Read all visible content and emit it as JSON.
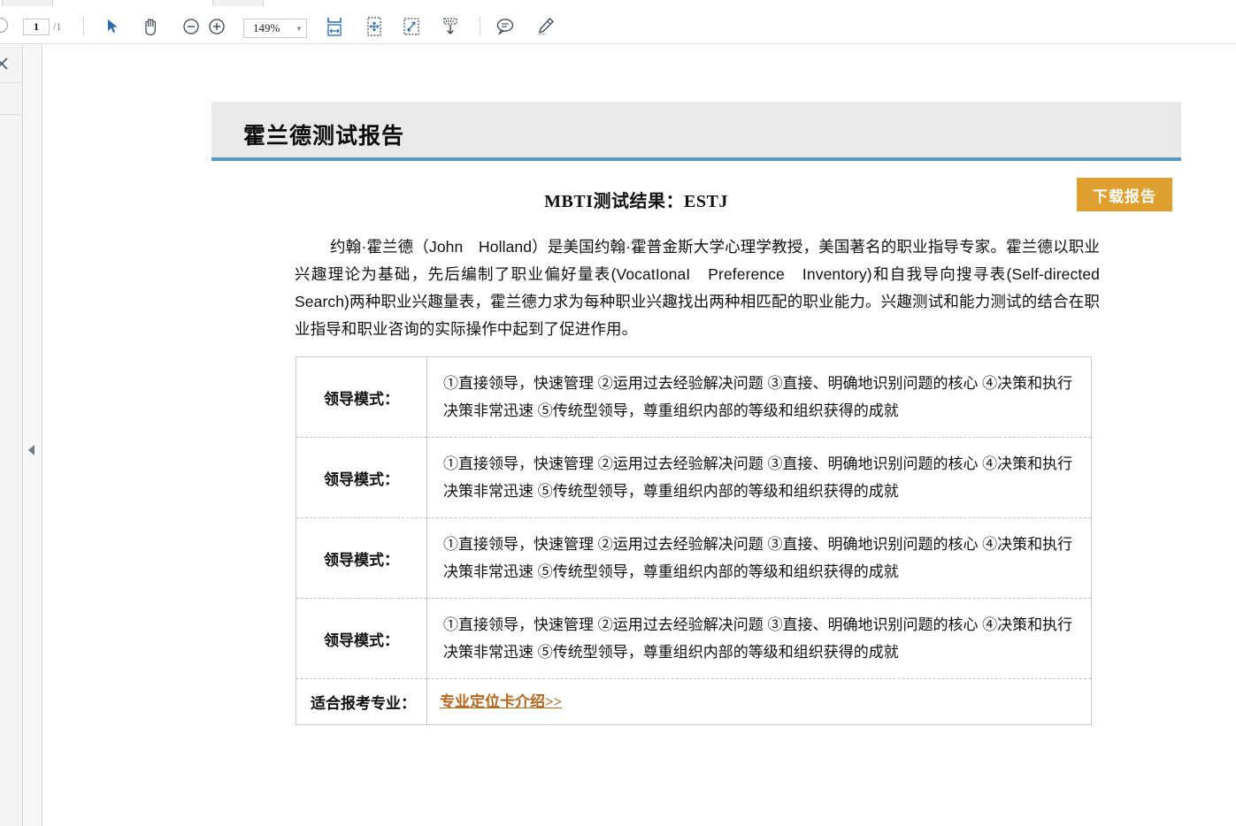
{
  "toolbar": {
    "page_number": "1",
    "page_total": "/1",
    "zoom_value": "149%",
    "zoom_caret": "▼",
    "icons": {
      "nav_back": "back-circle-icon",
      "select": "select-cursor-icon",
      "hand": "hand-tool-icon",
      "zoom_out": "zoom-out-icon",
      "zoom_in": "zoom-in-icon",
      "fit_width": "fit-width-icon",
      "fit_page": "fit-page-icon",
      "zoom_selection": "zoom-to-selection-icon",
      "snapshot": "snapshot-download-icon",
      "comment": "comment-bubble-icon",
      "highlight": "highlighter-pen-icon"
    }
  },
  "left_panel": {
    "close_label": "close-panel-icon",
    "collapse_label": "collapse-panel-arrow"
  },
  "report": {
    "header_title": "霍兰德测试报告",
    "mbti_line": "MBTI测试结果：ESTJ",
    "download_button": "下载报告",
    "intro": "约翰·霍兰德（John　Holland）是美国约翰·霍普金斯大学心理学教授，美国著名的职业指导专家。霍兰德以职业兴趣理论为基础，先后编制了职业偏好量表(VocatIonaI　Preference　Inventory)和自我导向搜寻表(Self-directed　Search)两种职业兴趣量表，霍兰德力求为每种职业兴趣找出两种相匹配的职业能力。兴趣测试和能力测试的结合在职业指导和职业咨询的实际操作中起到了促进作用。",
    "table": {
      "rows": [
        {
          "label": "领导模式：",
          "text": "①直接领导，快速管理 ②运用过去经验解决问题 ③直接、明确地识别问题的核心 ④决策和执行决策非常迅速 ⑤传统型领导，尊重组织内部的等级和组织获得的成就"
        },
        {
          "label": "领导模式：",
          "text": "①直接领导，快速管理 ②运用过去经验解决问题 ③直接、明确地识别问题的核心 ④决策和执行决策非常迅速 ⑤传统型领导，尊重组织内部的等级和组织获得的成就"
        },
        {
          "label": "领导模式：",
          "text": "①直接领导，快速管理 ②运用过去经验解决问题 ③直接、明确地识别问题的核心 ④决策和执行决策非常迅速 ⑤传统型领导，尊重组织内部的等级和组织获得的成就"
        },
        {
          "label": "领导模式：",
          "text": "①直接领导，快速管理 ②运用过去经验解决问题 ③直接、明确地识别问题的核心 ④决策和执行决策非常迅速 ⑤传统型领导，尊重组织内部的等级和组织获得的成就"
        }
      ],
      "last_row": {
        "label": "适合报考专业：",
        "link_text": "专业定位卡介绍>>"
      }
    }
  },
  "colors": {
    "accent_blue": "#5a9ac4",
    "header_gray": "#e9e9e9",
    "button_orange": "#e0a030",
    "link_brown": "#b5651d",
    "toolbar_icon_blue": "#2b6cb0"
  }
}
